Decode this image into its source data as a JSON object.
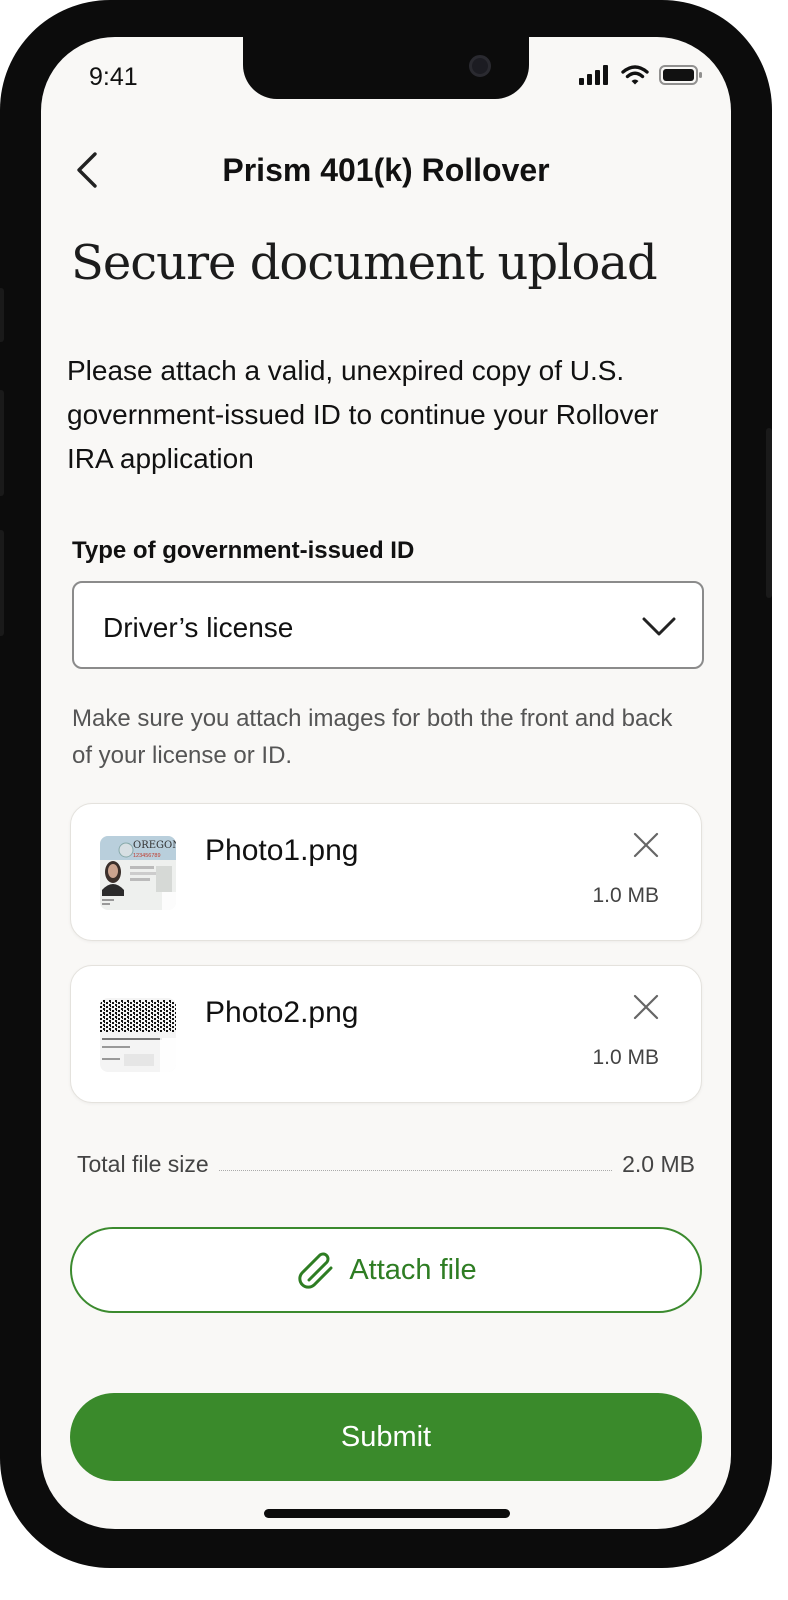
{
  "status_bar": {
    "time": "9:41"
  },
  "nav": {
    "title": "Prism 401(k) Rollover"
  },
  "page": {
    "heading": "Secure document upload",
    "intro": "Please attach a valid, unexpired copy of U.S. government-issued ID to continue your Rollover IRA application"
  },
  "id_type": {
    "label": "Type of government-issued ID",
    "selected": "Driver’s license"
  },
  "hint": "Make sure you attach images for both the front and back of your license or ID.",
  "files": [
    {
      "name": "Photo1.png",
      "size": "1.0 MB",
      "thumbnail": "oregon-license-front"
    },
    {
      "name": "Photo2.png",
      "size": "1.0 MB",
      "thumbnail": "license-back-barcode"
    }
  ],
  "total": {
    "label": "Total file size",
    "value": "2.0 MB"
  },
  "actions": {
    "attach_label": "Attach file",
    "submit_label": "Submit"
  },
  "thumb_text": {
    "state": "OREGON",
    "number": "123456789"
  },
  "colors": {
    "accent": "#3a8a2b",
    "background": "#f9f8f6"
  }
}
